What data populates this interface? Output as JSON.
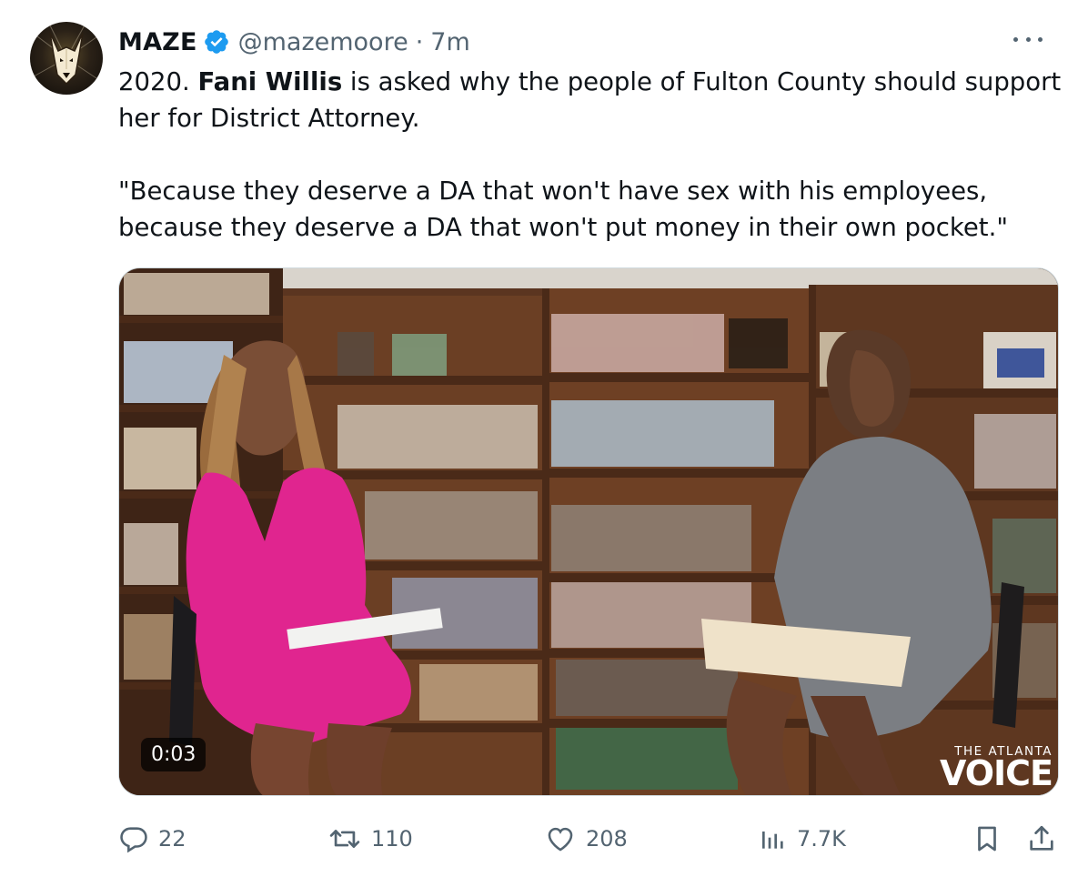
{
  "tweet": {
    "author": {
      "name": "MAZE",
      "handle": "@mazemoore",
      "verified_icon": "verified-badge-icon",
      "avatar_icon": "doberman-avatar-icon"
    },
    "separator": "·",
    "time": "7m",
    "text": {
      "p1_pre": "2020. ",
      "p1_bold": "Fani Willis",
      "p1_post": " is asked why the people of Fulton County should support her for District Attorney.",
      "p2": "\"Because they deserve a DA that won't have sex with his employees, because they deserve a DA that won't put money in their own pocket.\""
    },
    "media": {
      "type": "video",
      "duration": "0:03",
      "watermark_line1": "THE ATLANTA",
      "watermark_line2": "VOICE"
    },
    "actions": {
      "replies": "22",
      "reposts": "110",
      "likes": "208",
      "views": "7.7K"
    }
  },
  "colors": {
    "text_primary": "#0f1419",
    "text_secondary": "#536471",
    "verified_blue": "#1d9bf0",
    "border": "#cfd9de"
  },
  "icons": [
    "more-icon",
    "reply-icon",
    "repost-icon",
    "like-icon",
    "views-icon",
    "bookmark-icon",
    "share-icon"
  ]
}
